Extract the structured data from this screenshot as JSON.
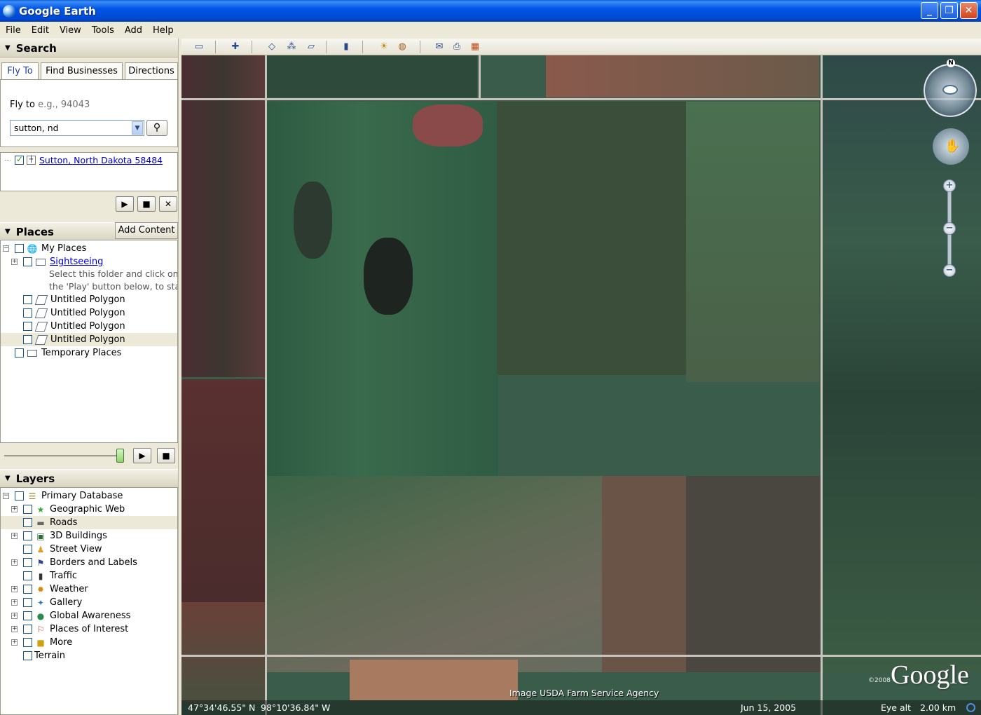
{
  "window": {
    "title": "Google Earth",
    "min": "_",
    "max": "❐",
    "close": "✕"
  },
  "menu": [
    "File",
    "Edit",
    "View",
    "Tools",
    "Add",
    "Help"
  ],
  "search": {
    "header": "Search",
    "tabs": [
      "Fly To",
      "Find Businesses",
      "Directions"
    ],
    "flyto_label": "Fly to",
    "flyto_hint": "e.g., 94043",
    "input_value": "sutton, nd",
    "result": "Sutton, North Dakota 58484"
  },
  "places": {
    "header": "Places",
    "add_content": "Add Content",
    "items": [
      {
        "label": "My Places"
      },
      {
        "label": "Sightseeing"
      },
      {
        "label": "Select this folder and click on"
      },
      {
        "label": "the 'Play' button below, to start"
      },
      {
        "label": "Untitled Polygon"
      },
      {
        "label": "Untitled Polygon"
      },
      {
        "label": "Untitled Polygon"
      },
      {
        "label": "Untitled Polygon"
      },
      {
        "label": "Temporary Places"
      }
    ]
  },
  "layers": {
    "header": "Layers",
    "items": [
      {
        "label": "Primary Database"
      },
      {
        "label": "Geographic Web"
      },
      {
        "label": "Roads"
      },
      {
        "label": "3D Buildings"
      },
      {
        "label": "Street View"
      },
      {
        "label": "Borders and Labels"
      },
      {
        "label": "Traffic"
      },
      {
        "label": "Weather"
      },
      {
        "label": "Gallery"
      },
      {
        "label": "Global Awareness"
      },
      {
        "label": "Places of Interest"
      },
      {
        "label": "More"
      },
      {
        "label": "Terrain"
      }
    ]
  },
  "map": {
    "compass_n": "N",
    "logo": "Google",
    "copyright": "©2008",
    "imagery_credit": "Image USDA Farm Service Agency",
    "lat": "47°34'46.55\" N",
    "lon": "98°10'36.84\" W",
    "date": "Jun 15, 2005",
    "eye_alt_label": "Eye alt",
    "eye_alt_value": "2.00 km"
  }
}
